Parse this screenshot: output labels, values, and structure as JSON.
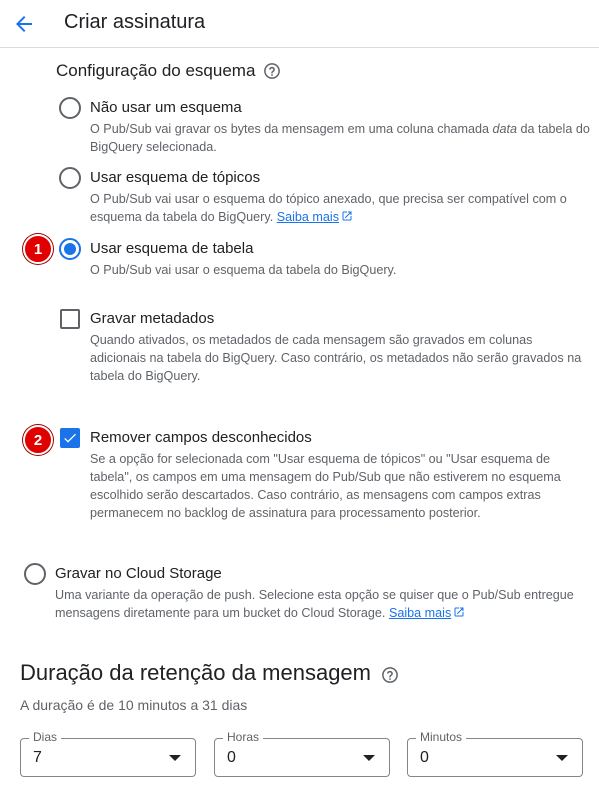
{
  "header": {
    "title": "Criar assinatura"
  },
  "schema_config": {
    "title": "Configuração do esquema",
    "options": [
      {
        "title": "Não usar um esquema",
        "desc_before": "O Pub/Sub vai gravar os bytes da mensagem em uma coluna chamada ",
        "desc_em": "data",
        "desc_after": " da tabela do BigQuery selecionada.",
        "checked": false
      },
      {
        "title": "Usar esquema de tópicos",
        "desc": "O Pub/Sub vai usar o esquema do tópico anexado, que precisa ser compatível com o esquema da tabela do BigQuery.",
        "link": "Saiba mais",
        "checked": false
      },
      {
        "title": "Usar esquema de tabela",
        "desc": "O Pub/Sub vai usar o esquema da tabela do BigQuery.",
        "checked": true
      }
    ],
    "write_metadata": {
      "title": "Gravar metadados",
      "desc": "Quando ativados, os metadados de cada mensagem são gravados em colunas adicionais na tabela do BigQuery. Caso contrário, os metadados não serão gravados na tabela do BigQuery.",
      "checked": false
    },
    "drop_unknown": {
      "title": "Remover campos desconhecidos",
      "desc": "Se a opção for selecionada com \"Usar esquema de tópicos\" ou \"Usar esquema de tabela\", os campos em uma mensagem do Pub/Sub que não estiverem no esquema escolhido serão descartados. Caso contrário, as mensagens com campos extras permanecem no backlog de assinatura para processamento posterior.",
      "checked": true
    }
  },
  "cloud_storage": {
    "title": "Gravar no Cloud Storage",
    "desc": "Uma variante da operação de push. Selecione esta opção se quiser que o Pub/Sub entregue mensagens diretamente para um bucket do Cloud Storage.",
    "link": "Saiba mais",
    "checked": false
  },
  "badges": {
    "one": "1",
    "two": "2"
  },
  "retention": {
    "title": "Duração da retenção da mensagem",
    "subtitle": "A duração é de 10 minutos a 31 dias",
    "fields": [
      {
        "label": "Dias",
        "value": "7"
      },
      {
        "label": "Horas",
        "value": "0"
      },
      {
        "label": "Minutos",
        "value": "0"
      }
    ]
  },
  "colors": {
    "accent": "#1a73e8",
    "badge": "#e00000",
    "text": "#202124",
    "muted": "#5f6368"
  }
}
